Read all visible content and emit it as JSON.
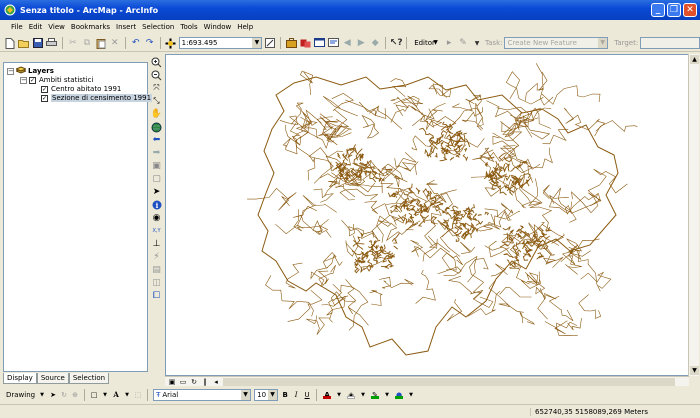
{
  "window": {
    "title": "Senza titolo - ArcMap - ArcInfo"
  },
  "menu": [
    "File",
    "Edit",
    "View",
    "Bookmarks",
    "Insert",
    "Selection",
    "Tools",
    "Window",
    "Help"
  ],
  "toolbar": {
    "scale_value": "1:693.495",
    "editor_label": "Editor",
    "task_label": "Task:",
    "task_value": "Create New Feature",
    "target_label": "Target:",
    "target_value": ""
  },
  "toc": {
    "root": "Layers",
    "group": "Ambiti statistici",
    "layers": [
      "Centro abitato 1991",
      "Sezione di censimento 1991"
    ],
    "tabs": [
      "Display",
      "Source",
      "Selection"
    ]
  },
  "drawing": {
    "label": "Drawing",
    "font_name": "Arial",
    "font_size": "10",
    "bold": "B",
    "italic": "I",
    "underline": "U",
    "font_color_letter": "A"
  },
  "status": {
    "coords": "652740,35  5158089,269 Meters"
  },
  "colors": {
    "map_lines": "#8b5a10",
    "title_blue": "#0a4ad6",
    "font_color": "#c00000",
    "line_color": "#00a000"
  }
}
